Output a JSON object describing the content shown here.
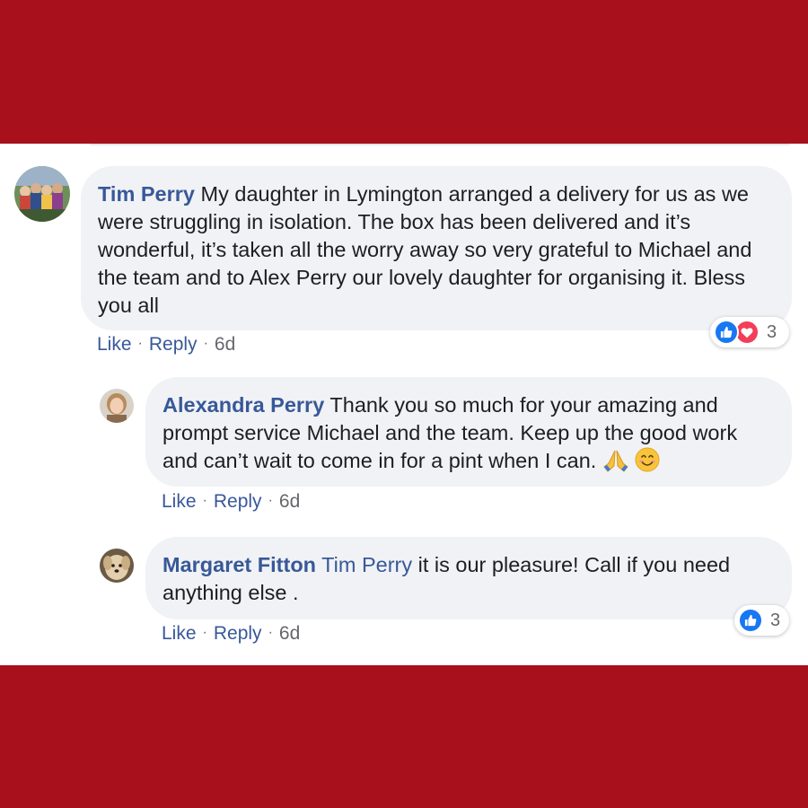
{
  "colors": {
    "band": "#a8101c",
    "link": "#385898",
    "bubble_bg": "#f0f2f5",
    "like_blue": "#1877f2",
    "love_red": "#f33e58"
  },
  "comments": [
    {
      "author": "Tim Perry",
      "text": "My daughter in Lymington arranged a delivery for us as we were struggling in isolation. The box has been delivered and it’s wonderful, it’s taken all the worry away so very grateful to Michael and the team and to Alex Perry our lovely daughter for organising it. Bless you all",
      "actions": {
        "like": "Like",
        "reply": "Reply",
        "time": "6d"
      },
      "reactions": {
        "icons": [
          "like-icon",
          "love-icon"
        ],
        "count": "3"
      }
    },
    {
      "author": "Alexandra Perry",
      "text": "Thank you so much for your amazing and prompt service Michael and the team. Keep up the good work and can’t wait to come in for a pint when I can.",
      "emojis": [
        "folded-hands-emoji",
        "smiling-face-emoji"
      ],
      "actions": {
        "like": "Like",
        "reply": "Reply",
        "time": "6d"
      }
    },
    {
      "author": "Margaret Fitton",
      "mention": "Tim Perry",
      "text": "it is our pleasure! Call if you need anything else .",
      "actions": {
        "like": "Like",
        "reply": "Reply",
        "time": "6d"
      },
      "reactions": {
        "icons": [
          "like-icon"
        ],
        "count": "3"
      }
    }
  ]
}
